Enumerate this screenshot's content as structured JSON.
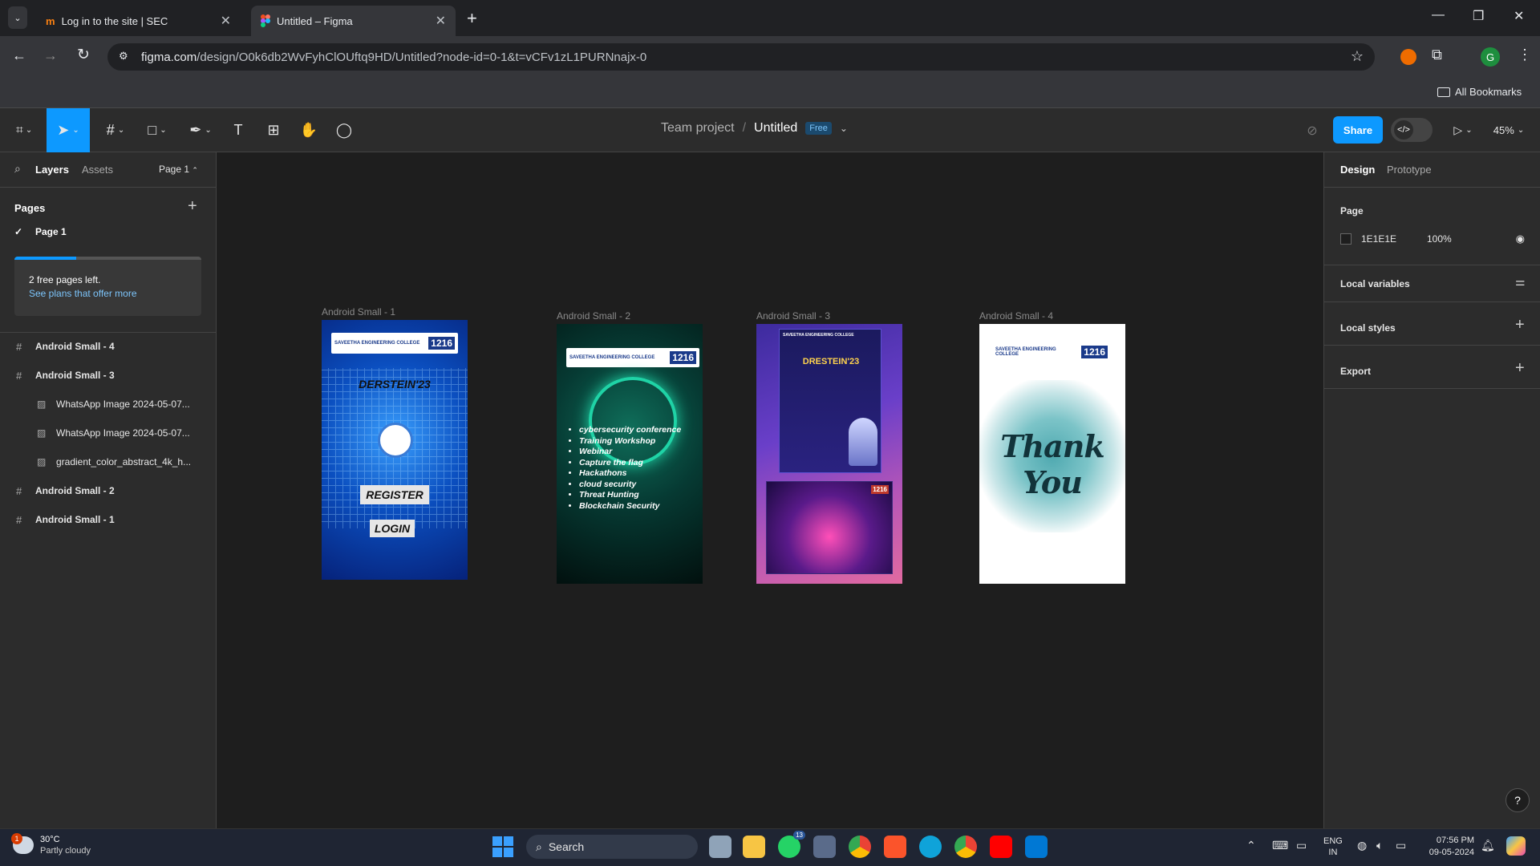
{
  "browser": {
    "tabs": [
      {
        "title": "Log in to the site | SEC",
        "active": false
      },
      {
        "title": "Untitled – Figma",
        "active": true
      }
    ],
    "url_host": "figma.com",
    "url_path": "/design/O0k6db2WvFyhClOUftq9HD/Untitled?node-id=0-1&t=vCFv1zL1PURNnajx-0",
    "profile_initial": "G",
    "bookmarks_label": "All Bookmarks"
  },
  "figma": {
    "breadcrumb_team": "Team project",
    "breadcrumb_sep": "/",
    "file_name": "Untitled",
    "plan_badge": "Free",
    "share_label": "Share",
    "zoom": "45%"
  },
  "left_panel": {
    "tab_layers": "Layers",
    "tab_assets": "Assets",
    "page_selector": "Page 1",
    "pages_title": "Pages",
    "current_page": "Page 1",
    "notice_text": "2 free pages left.",
    "notice_link": "See plans that offer more",
    "notice_progress": 0.33,
    "layers": [
      {
        "label": "Android Small - 4",
        "type": "frame",
        "indent": 0
      },
      {
        "label": "Android Small - 3",
        "type": "frame",
        "indent": 0
      },
      {
        "label": "WhatsApp Image 2024-05-07...",
        "type": "image",
        "indent": 1
      },
      {
        "label": "WhatsApp Image 2024-05-07...",
        "type": "image",
        "indent": 1
      },
      {
        "label": "gradient_color_abstract_4k_h...",
        "type": "image",
        "indent": 1
      },
      {
        "label": "Android Small - 2",
        "type": "frame",
        "indent": 0
      },
      {
        "label": "Android Small - 1",
        "type": "frame",
        "indent": 0
      }
    ]
  },
  "canvas": {
    "frames": [
      {
        "label": "Android Small - 1",
        "college": "SAVEETHA ENGINEERING COLLEGE",
        "code": "1216",
        "title": "DERSTEIN'23",
        "buttons": [
          "REGISTER",
          "LOGIN"
        ]
      },
      {
        "label": "Android Small - 2",
        "college": "SAVEETHA ENGINEERING COLLEGE",
        "code": "1216",
        "items": [
          "cybersecurity conference",
          "Training Workshop",
          "Webinar",
          "Capture the flag",
          "Hackathons",
          "cloud security",
          "Threat Hunting",
          "Blockchain Security"
        ]
      },
      {
        "label": "Android Small - 3",
        "college": "SAVEETHA ENGINEERING COLLEGE",
        "code": "1216",
        "title": "DRESTEIN'23"
      },
      {
        "label": "Android Small - 4",
        "college": "SAVEETHA ENGINEERING COLLEGE",
        "code": "1216",
        "message": "Thank You"
      }
    ]
  },
  "right_panel": {
    "tab_design": "Design",
    "tab_prototype": "Prototype",
    "page_section": "Page",
    "page_color_hex": "1E1E1E",
    "page_opacity": "100%",
    "local_variables": "Local variables",
    "local_styles": "Local styles",
    "export": "Export",
    "help": "?"
  },
  "taskbar": {
    "temp": "30°C",
    "weather": "Partly cloudy",
    "weather_badge": "1",
    "search": "Search",
    "lang1": "ENG",
    "lang2": "IN",
    "time": "07:56 PM",
    "date": "09-05-2024",
    "whatsapp_badge": "13"
  },
  "colors": {
    "accent": "#0d99ff",
    "figma_bg": "#2c2c2c",
    "canvas_bg": "#1e1e1e"
  }
}
